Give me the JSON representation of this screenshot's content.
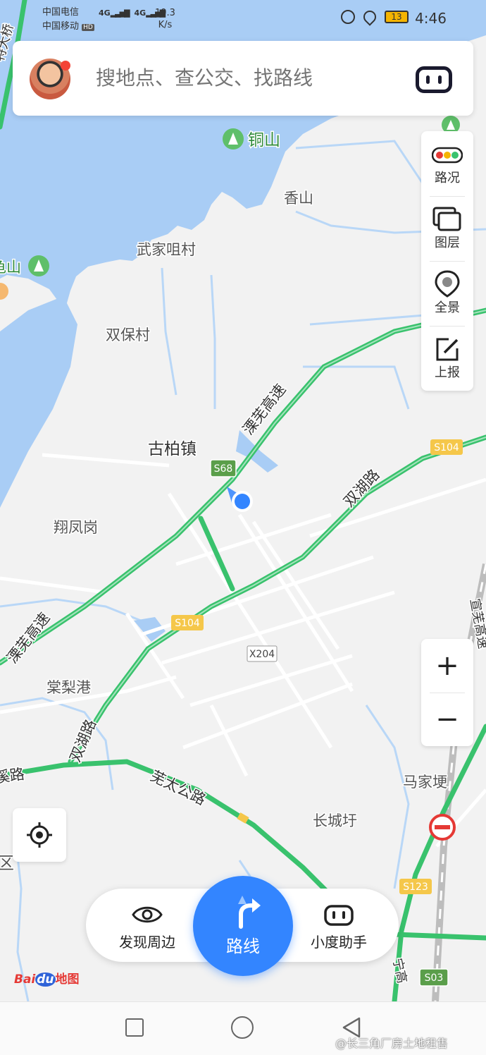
{
  "status_bar": {
    "carrier1": "中国电信",
    "carrier2": "中国移动",
    "hd_badge": "HD",
    "signal1": "4G",
    "signal2": "4G",
    "speed_value": "19.3",
    "speed_unit": "K/s",
    "battery": "13",
    "time": "4:46"
  },
  "search": {
    "placeholder": "搜地点、查公交、找路线"
  },
  "right_panel": {
    "traffic_label": "路况",
    "layers_label": "图层",
    "panorama_label": "全景",
    "report_label": "上报"
  },
  "zoom": {
    "in_label": "+",
    "out_label": "−"
  },
  "bottom_bar": {
    "discover_label": "发现周边",
    "route_label": "路线",
    "assistant_label": "小度助手"
  },
  "brand": {
    "logo_text_1": "Bai",
    "logo_text_2": "du",
    "logo_text_3": "地图"
  },
  "map": {
    "places": {
      "tongshan": "铜山",
      "xiangshan": "香山",
      "wujiajucun": "武家咀村",
      "guishan_partial": "龟山",
      "shuangbaocun": "双保村",
      "gubaizhen": "古柏镇",
      "xiangfenggang": "翔凤岗",
      "tangligang": "棠梨港",
      "majiageng": "马家埂",
      "changchengyu": "长城圩",
      "qu_partial": "区"
    },
    "roads": {
      "lishu_expressway_upper": "溧芜高速",
      "lishu_expressway_lower": "溧芜高速",
      "shuanghu_road_upper": "双湖路",
      "shuanghu_road_lower": "双湖路",
      "wutai_road": "芜太公路",
      "xi_road_partial": "溪路",
      "top_left_partial": "特大桥",
      "right_vertical_partial": "宣芜高速",
      "ning_gao_partial": "宁高"
    },
    "badges": {
      "s68": "S68",
      "s104_right": "S104",
      "s104_center": "S104",
      "x204": "X204",
      "s123": "S123",
      "s03": "S03"
    }
  },
  "watermark": "@长三角厂房土地租售",
  "colors": {
    "water": "#a9cdf5",
    "land": "#f2f2f2",
    "expressway": "#39c26d",
    "minor_road": "#ffffff",
    "accent_blue": "#3385ff",
    "badge_green": "#5a9e4a",
    "badge_yellow": "#f5c74a",
    "no_entry_red": "#e53935"
  }
}
